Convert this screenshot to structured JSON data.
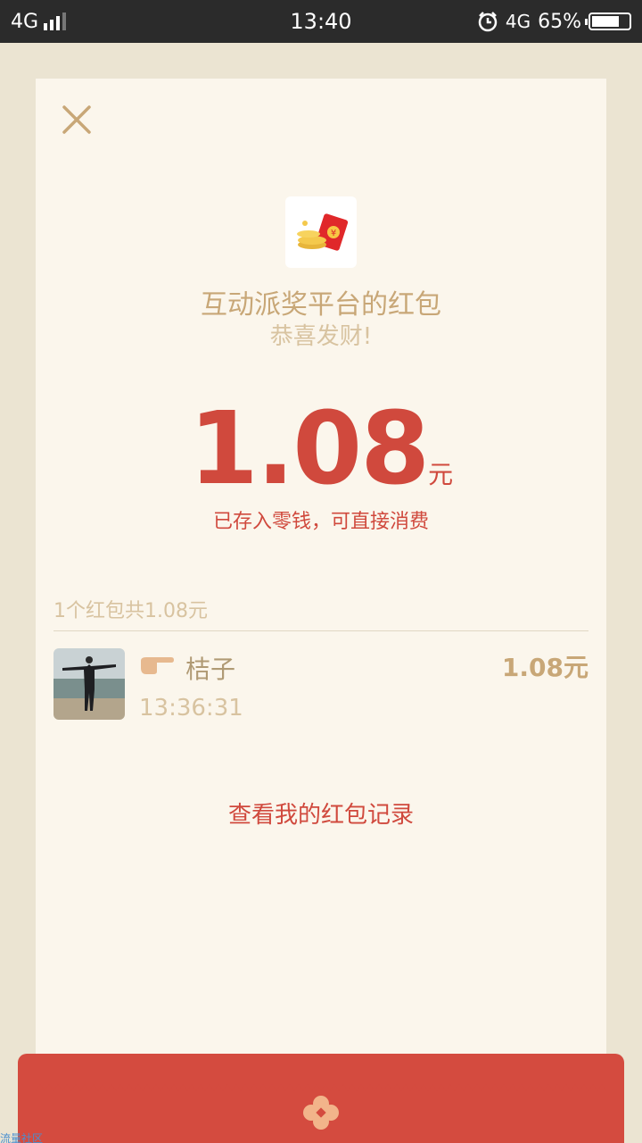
{
  "status_bar": {
    "network": "4G",
    "time": "13:40",
    "network_right": "4G",
    "battery": "65%"
  },
  "card": {
    "title": "互动派奖平台的红包",
    "wish": "恭喜发财!",
    "amount": "1.08",
    "amount_unit": "元",
    "stored_note": "已存入零钱，可直接消费",
    "summary": "1个红包共1.08元",
    "record": {
      "name": "桔子",
      "time": "13:36:31",
      "amount": "1.08元"
    },
    "history_link": "查看我的红包记录"
  },
  "colors": {
    "accent_red": "#d0493d",
    "gold": "#c8a777",
    "card_bg": "#fbf6ec"
  },
  "watermark": "流量社区"
}
